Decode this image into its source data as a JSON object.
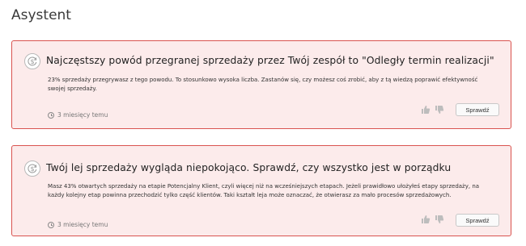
{
  "page": {
    "title": "Asystent"
  },
  "cards": [
    {
      "icon": "dollar-cycle-icon",
      "title": "Najczęstszy powód przegranej sprzedaży przez Twój zespół to \"Odległy termin realizacji\"",
      "description": "23% sprzedaży przegrywasz z tego powodu. To stosunkowo wysoka liczba. Zastanów się, czy możesz coś zrobić, aby z tą wiedzą poprawić efektywność swojej sprzedaży.",
      "time": "3 miesięcy temu",
      "button": "Sprawdź"
    },
    {
      "icon": "dollar-cycle-icon",
      "title": "Twój lej sprzedaży wygląda niepokojąco. Sprawdź, czy wszystko jest w porządku",
      "description": "Masz 43% otwartych sprzedaży na etapie Potencjalny Klient, czyli więcej niż na wcześniejszych etapach. Jeżeli prawidłowo ułożyłeś etapy sprzedaży, na każdy kolejny etap powinna przechodzić tylko część klientów. Taki kształt leja może oznaczać, że otwierasz za mało procesów sprzedażowych.",
      "time": "3 miesięcy temu",
      "button": "Sprawdź"
    }
  ],
  "colors": {
    "card_bg": "#fcebeb",
    "card_border": "#d9534f"
  }
}
